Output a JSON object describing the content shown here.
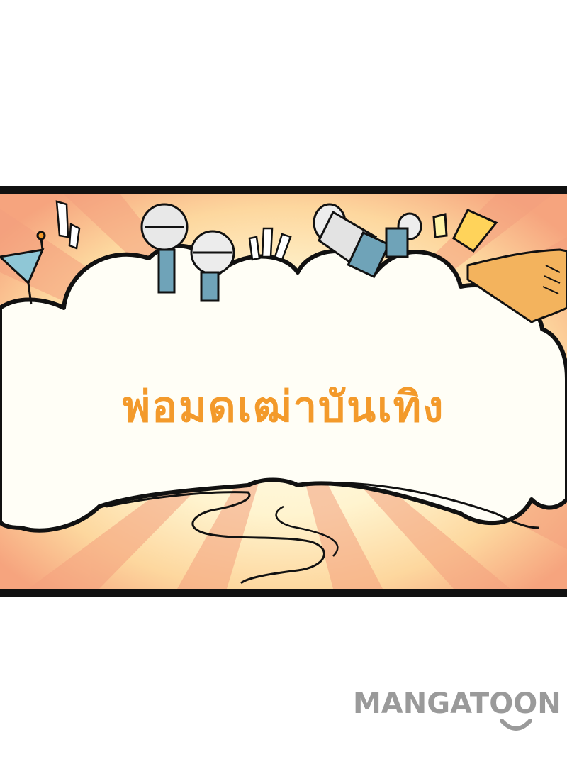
{
  "panel": {
    "title": "พ่อมดเฒ่าบันเทิง"
  },
  "watermark": {
    "text": "MANGATOON",
    "icon": "smile-icon"
  },
  "colors": {
    "title": "#f39a2b",
    "border": "#111111",
    "burst_light": "#fffbe8",
    "burst_warm": "#f7a985",
    "watermark": "#9a9a9a"
  },
  "decorations": [
    "cocktail-glass-icon",
    "lollipop-icon",
    "microphone-icon",
    "spotlight-icon",
    "boot-icon",
    "sparkle-marks-icon"
  ]
}
